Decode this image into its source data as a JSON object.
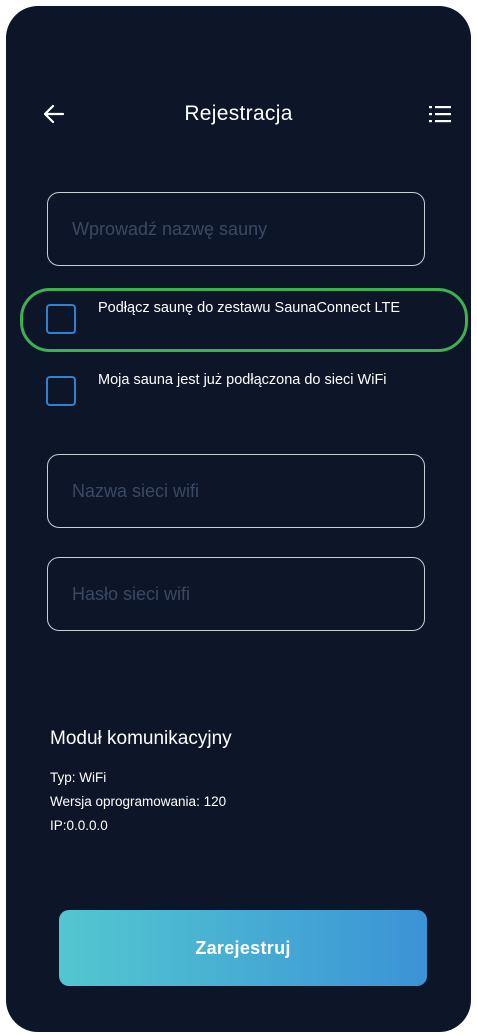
{
  "header": {
    "title": "Rejestracja",
    "back_icon": "arrow-left-icon",
    "menu_icon": "list-menu-icon"
  },
  "form": {
    "sauna_name": {
      "placeholder": "Wprowadź nazwę sauny",
      "value": ""
    },
    "checkbox_lte": {
      "label": "Podłącz saunę do zestawu SaunaConnect LTE",
      "checked": false
    },
    "checkbox_wifi": {
      "label": "Moja sauna jest już podłączona do sieci WiFi",
      "checked": false
    },
    "wifi_name": {
      "placeholder": "Nazwa sieci wifi",
      "value": ""
    },
    "wifi_password": {
      "placeholder": "Hasło sieci wifi",
      "value": ""
    }
  },
  "module": {
    "title": "Moduł komunikacyjny",
    "type": "Typ: WiFi",
    "firmware": "Wersja oprogramowania: 120",
    "ip": "IP:0.0.0.0"
  },
  "actions": {
    "register_label": "Zarejestruj"
  },
  "colors": {
    "background": "#0c1628",
    "accent": "#2f82d0",
    "highlight": "#3db04f",
    "button_gradient_start": "#53c7d0",
    "button_gradient_end": "#3b93d6"
  }
}
